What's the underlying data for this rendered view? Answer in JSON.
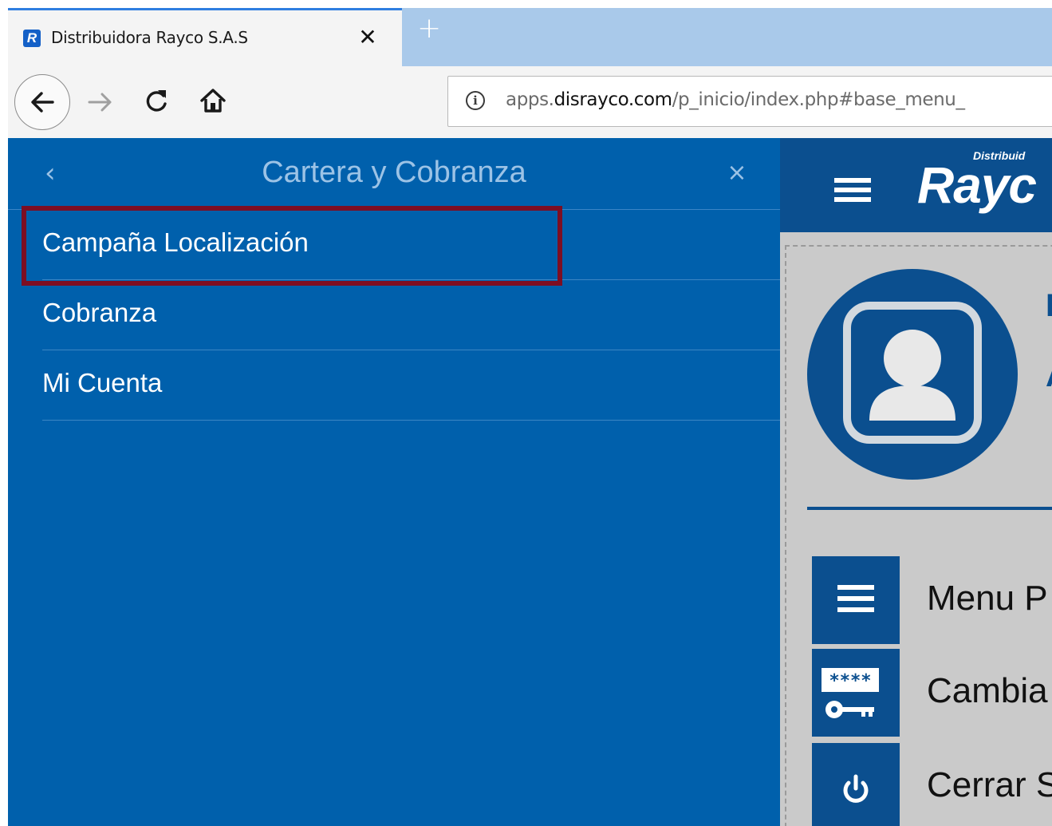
{
  "browser": {
    "tab": {
      "favicon_letter": "R",
      "title": "Distribuidora Rayco S.A.S",
      "close_glyph": "✕"
    },
    "new_tab_glyph": "+",
    "url": {
      "prefix": "apps.",
      "host": "disrayco.com",
      "path": "/p_inicio/index.php#base_menu_"
    },
    "icons": [
      "back-icon",
      "forward-icon",
      "reload-icon",
      "home-icon",
      "info-icon"
    ]
  },
  "sidebar": {
    "title": "Cartera y Cobranza",
    "back_glyph": "‹",
    "close_glyph": "×",
    "items": [
      {
        "label": "Campaña Localización",
        "highlighted": true
      },
      {
        "label": "Cobranza"
      },
      {
        "label": "Mi Cuenta"
      }
    ]
  },
  "app": {
    "logo_small": "Distribuid",
    "logo_big": "Rayc",
    "menu": [
      {
        "label": "Menu P",
        "icon": "menu-icon"
      },
      {
        "label": "Cambia",
        "icon": "password-key-icon"
      },
      {
        "label": "Cerrar S",
        "icon": "power-icon"
      }
    ],
    "password_mask": "****"
  },
  "colors": {
    "sidebar_bg": "#0060ac",
    "app_dark_blue": "#0b4f8f",
    "highlight_border": "#7d0e23",
    "tab_accent": "#2f7ee0"
  }
}
